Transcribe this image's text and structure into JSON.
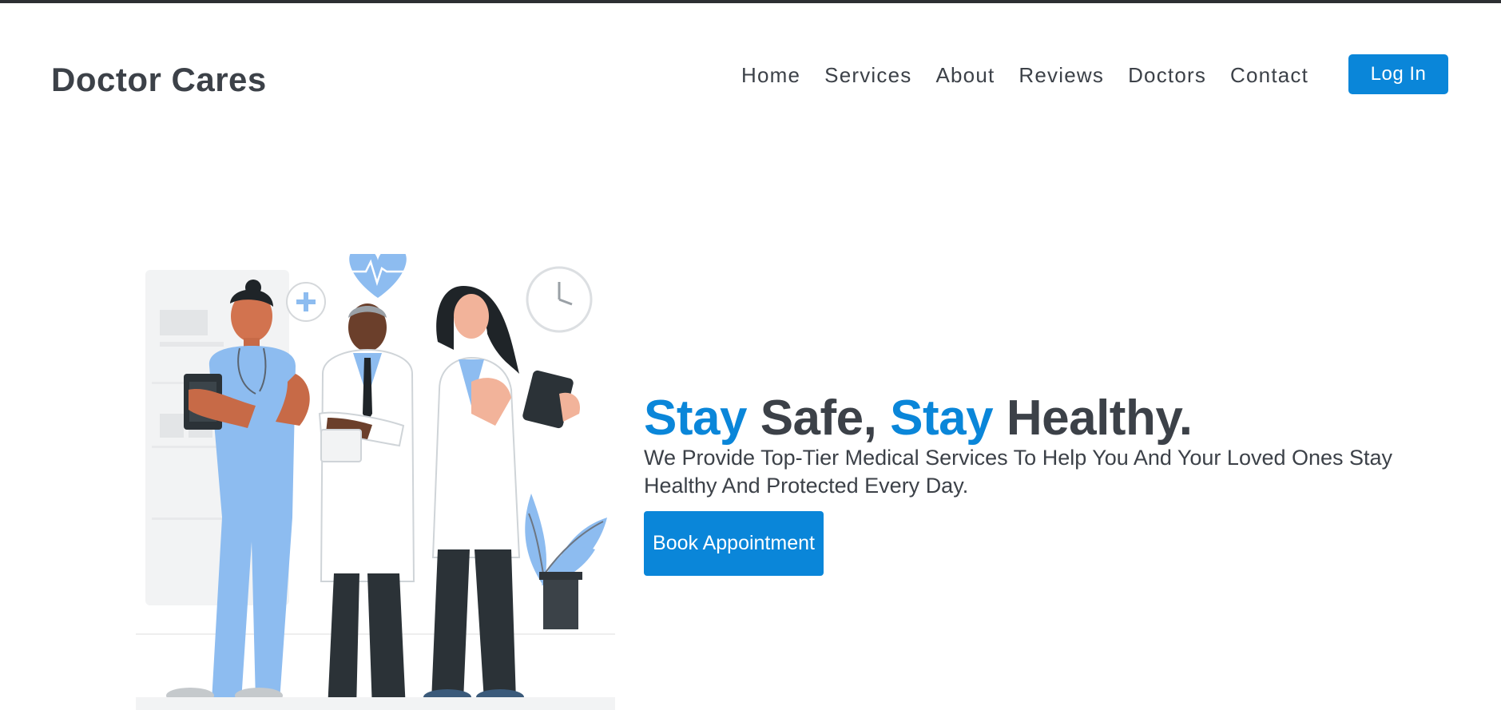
{
  "brand": {
    "name": "Doctor Cares"
  },
  "nav": {
    "items": [
      "Home",
      "Services",
      "About",
      "Reviews",
      "Doctors",
      "Contact"
    ],
    "login_label": "Log In"
  },
  "hero": {
    "headline": {
      "w1": "Stay",
      "w2": "Safe,",
      "w3": "Stay",
      "w4": "Healthy."
    },
    "subtext": "We Provide Top-Tier Medical Services To Help You And Your Loved Ones Stay Healthy And Protected Every Day.",
    "cta_label": "Book Appointment"
  },
  "colors": {
    "accent": "#0a86d9",
    "text": "#3c4148",
    "topbar": "#2d2f33"
  },
  "icons": [
    "heart-pulse-icon",
    "plus-chat-icon",
    "clock-icon"
  ]
}
